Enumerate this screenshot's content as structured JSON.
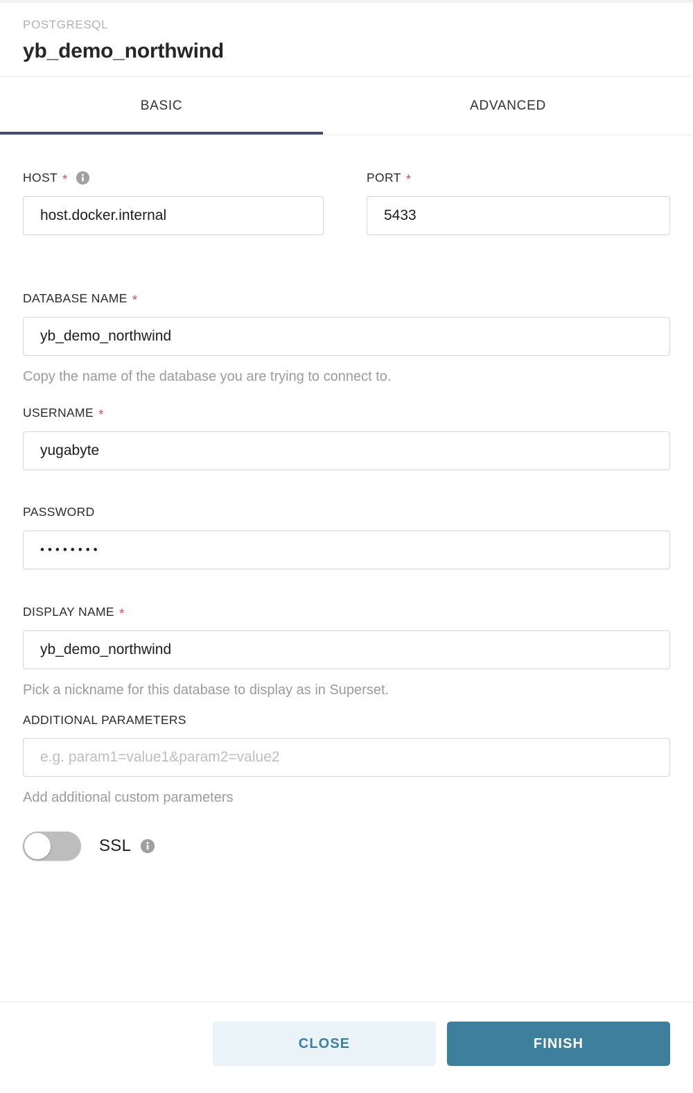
{
  "header": {
    "engine": "POSTGRESQL",
    "title": "yb_demo_northwind"
  },
  "tabs": [
    {
      "label": "BASIC",
      "active": true
    },
    {
      "label": "ADVANCED",
      "active": false
    }
  ],
  "fields": {
    "host": {
      "label": "HOST",
      "required": "*",
      "info_icon": "info-icon",
      "value": "host.docker.internal"
    },
    "port": {
      "label": "PORT",
      "required": "*",
      "value": "5433"
    },
    "database_name": {
      "label": "DATABASE NAME",
      "required": "*",
      "value": "yb_demo_northwind",
      "helper": "Copy the name of the database you are trying to connect to."
    },
    "username": {
      "label": "USERNAME",
      "required": "*",
      "value": "yugabyte"
    },
    "password": {
      "label": "PASSWORD",
      "value": "••••••••"
    },
    "display_name": {
      "label": "DISPLAY NAME",
      "required": "*",
      "value": "yb_demo_northwind",
      "helper": "Pick a nickname for this database to display as in Superset."
    },
    "additional_parameters": {
      "label": "ADDITIONAL PARAMETERS",
      "value": "",
      "placeholder": "e.g. param1=value1&param2=value2",
      "helper": "Add additional custom parameters"
    },
    "ssl": {
      "label": "SSL",
      "info_icon": "info-icon",
      "enabled": false
    }
  },
  "footer": {
    "close_label": "CLOSE",
    "finish_label": "FINISH"
  },
  "colors": {
    "accent_teal": "#3d7f9c",
    "tab_indicator": "#444a6b",
    "required_red": "#d0505e",
    "helper_gray": "#9b9b9b"
  }
}
